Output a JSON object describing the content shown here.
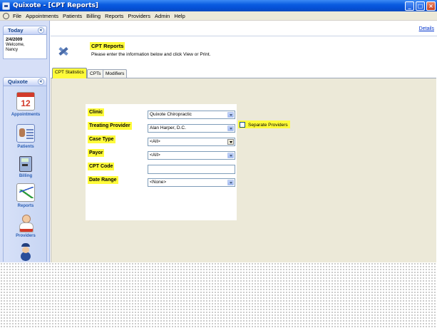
{
  "window": {
    "title": "Quixote - [CPT Reports]"
  },
  "menu": [
    "File",
    "Appointments",
    "Patients",
    "Billing",
    "Reports",
    "Providers",
    "Admin",
    "Help"
  ],
  "sidebar": {
    "today": {
      "header": "Today",
      "date": "2/4/2009",
      "welcome": "Welcome,",
      "user": "Nancy"
    },
    "nav": {
      "header": "Quixote",
      "items": [
        {
          "label": "Appointments",
          "icon": "calendar-icon"
        },
        {
          "label": "Patients",
          "icon": "patient-card-icon"
        },
        {
          "label": "Billing",
          "icon": "calculator-icon"
        },
        {
          "label": "Reports",
          "icon": "chart-icon"
        },
        {
          "label": "Providers",
          "icon": "doctor-icon"
        },
        {
          "label": "",
          "icon": "admin-icon"
        }
      ]
    }
  },
  "main": {
    "details_link": "Details",
    "header": {
      "title": "CPT Reports",
      "subtitle": "Please enter the information below and click View or Print."
    },
    "tabs": [
      {
        "label": "CPT Statistics",
        "active": true
      },
      {
        "label": "CPTs",
        "active": false
      },
      {
        "label": "Modifiers",
        "active": false
      }
    ],
    "form": {
      "clinic": {
        "label": "Clinic",
        "value": "Quixote Chiropractic"
      },
      "treating_provider": {
        "label": "Treating Provider",
        "value": "Alan Harper, D.C."
      },
      "separate_providers": {
        "label": "Separate Providers",
        "checked": false
      },
      "case_type": {
        "label": "Case Type",
        "value": "<All>"
      },
      "payor": {
        "label": "Payor",
        "value": "<All>"
      },
      "cpt_code": {
        "label": "CPT Code",
        "value": ""
      },
      "date_range": {
        "label": "Date Range",
        "value": "<None>"
      }
    }
  },
  "colors": {
    "highlight": "#fffb3a",
    "titlebar": "#0a5ce0",
    "sidebar": "#d6dff7",
    "link": "#0033cc"
  }
}
